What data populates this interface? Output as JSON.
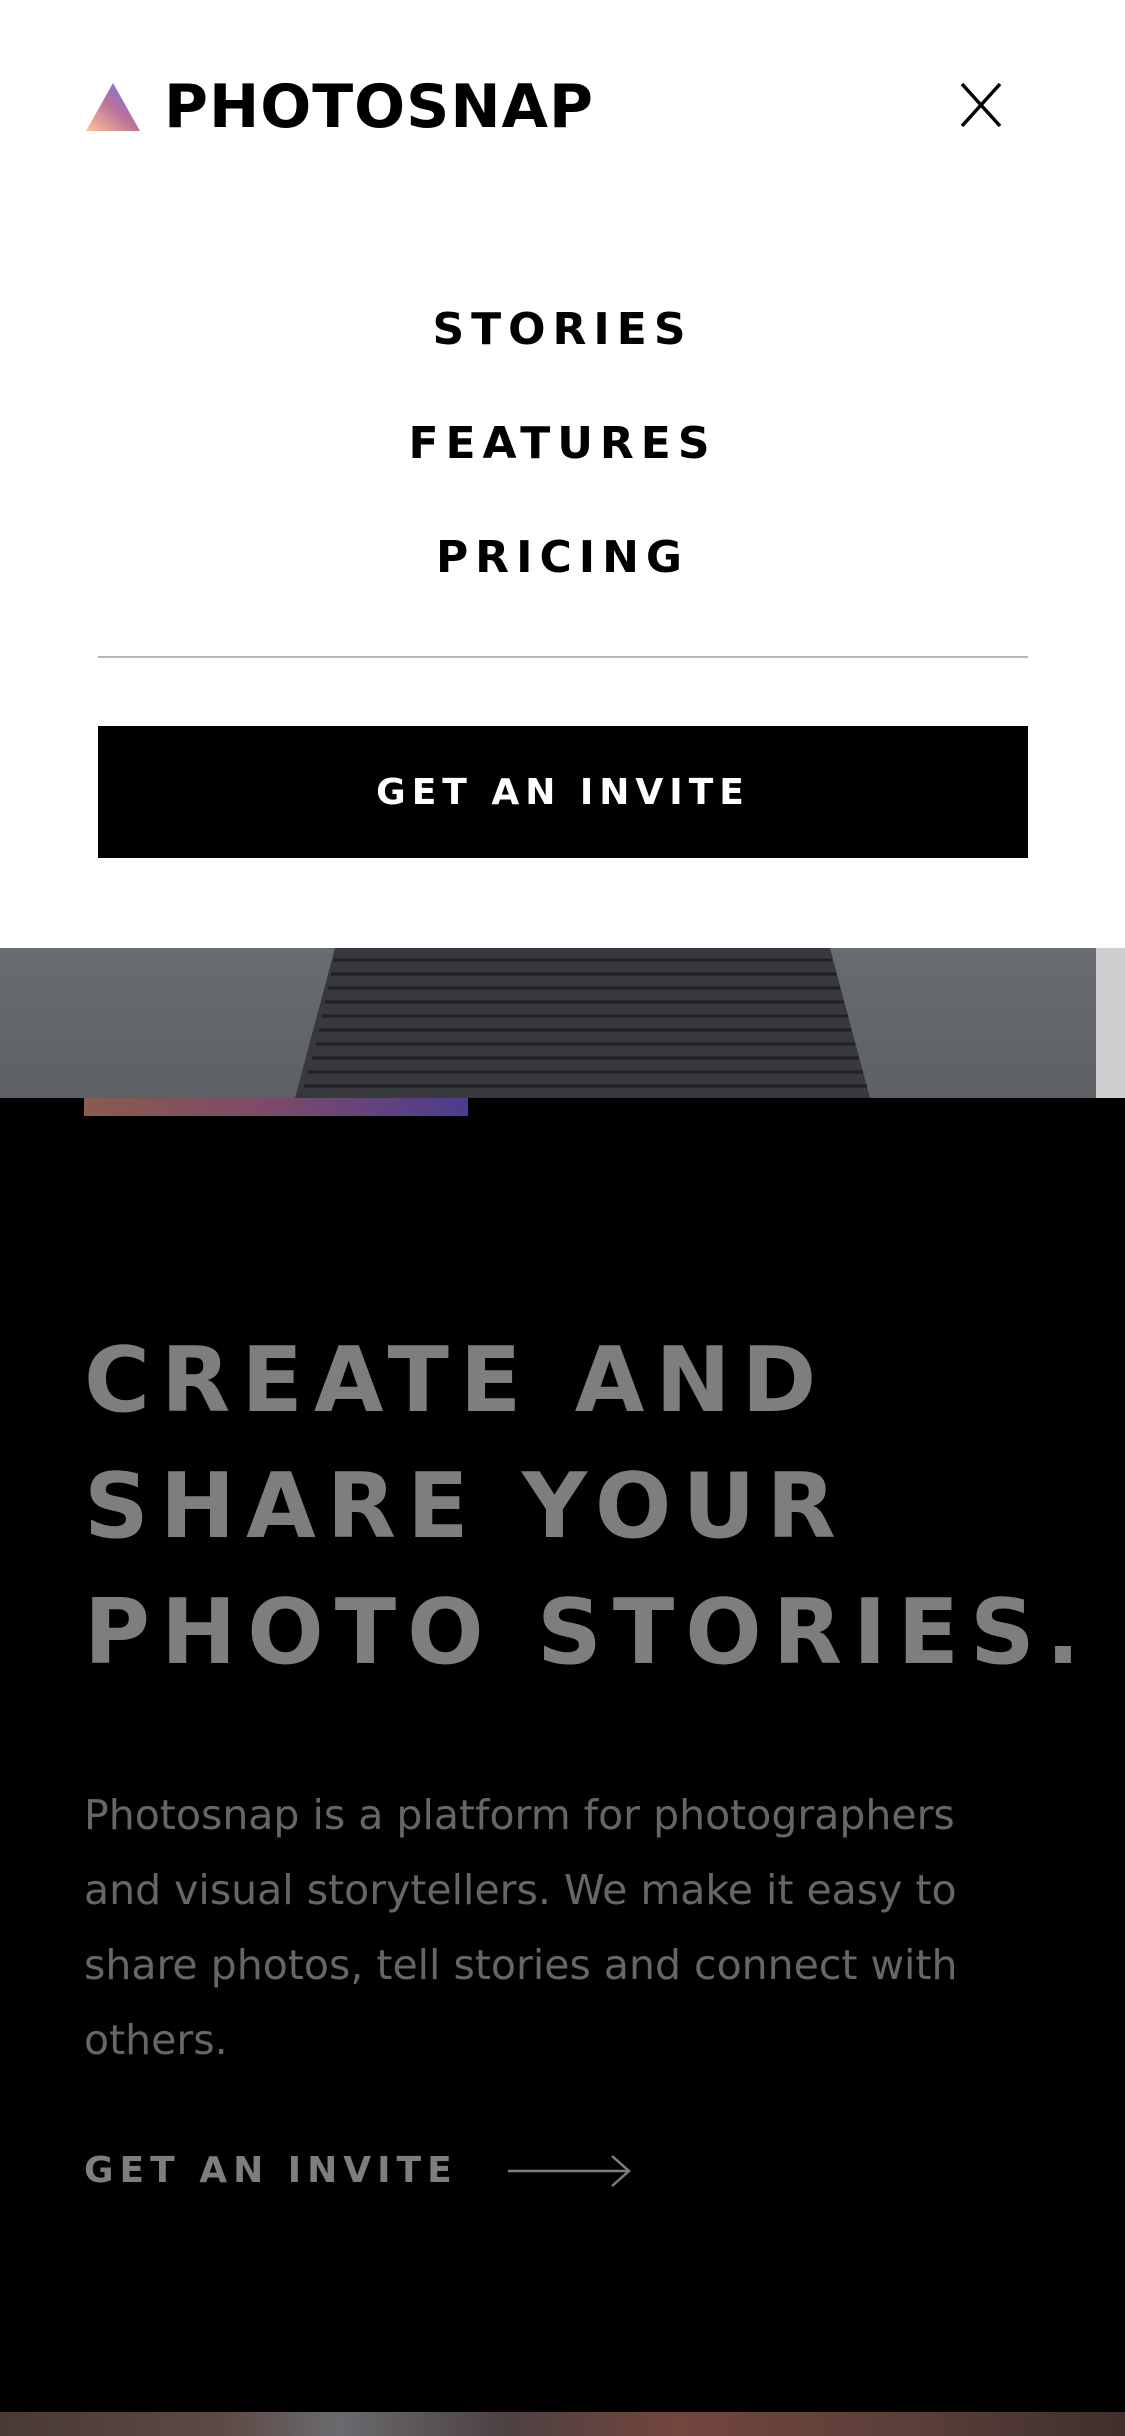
{
  "brand": {
    "name": "PHOTOSNAP",
    "logo_icon": "triangle-gradient-icon",
    "gradient_colors": [
      "#FFC593",
      "#BC7198",
      "#5A77FF"
    ]
  },
  "header": {
    "close_icon": "close-icon"
  },
  "menu": {
    "items": [
      {
        "label": "STORIES"
      },
      {
        "label": "FEATURES"
      },
      {
        "label": "PRICING"
      }
    ],
    "cta_label": "GET AN INVITE"
  },
  "hero": {
    "title_lines": [
      "CREATE AND",
      "SHARE YOUR",
      "PHOTO STORIES."
    ],
    "description": "Photosnap is a platform for photographers and visual storytellers. We make it easy to share photos, tell stories and connect with others.",
    "cta_label": "GET AN INVITE",
    "cta_icon": "arrow-right-icon"
  },
  "colors": {
    "background": "#000000",
    "menu_background": "#FFFFFF",
    "overlay_text": "#7E7E7E"
  }
}
